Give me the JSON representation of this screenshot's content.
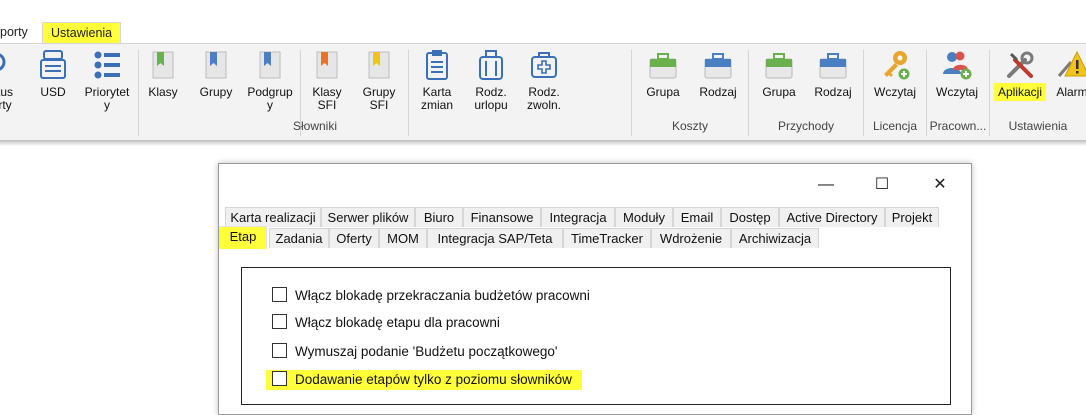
{
  "menu": {
    "tab_partial": "porty",
    "tab_active": "Ustawienia"
  },
  "ribbon": {
    "buttons": [
      {
        "id": "status",
        "label": "tus\nrty"
      },
      {
        "id": "usd",
        "label": "USD"
      },
      {
        "id": "priorytety",
        "label": "Priorytet\ny"
      },
      {
        "id": "klasy",
        "label": "Klasy"
      },
      {
        "id": "grupy",
        "label": "Grupy"
      },
      {
        "id": "podgrupy",
        "label": "Podgrup\ny"
      },
      {
        "id": "klasy_sfi",
        "label": "Klasy\nSFI"
      },
      {
        "id": "grupy_sfi",
        "label": "Grupy\nSFI"
      },
      {
        "id": "karta_zmian",
        "label": "Karta\nzmian"
      },
      {
        "id": "rodz_urlopu",
        "label": "Rodz.\nurlopu"
      },
      {
        "id": "rodz_zwoln",
        "label": "Rodz.\nzwoln."
      },
      {
        "id": "koszty_grupa",
        "label": "Grupa"
      },
      {
        "id": "koszty_rodzaj",
        "label": "Rodzaj"
      },
      {
        "id": "przychody_grupa",
        "label": "Grupa"
      },
      {
        "id": "przychody_rodzaj",
        "label": "Rodzaj"
      },
      {
        "id": "licencja_wczytaj",
        "label": "Wczytaj"
      },
      {
        "id": "pracown_wczytaj",
        "label": "Wczytaj"
      },
      {
        "id": "aplikacji",
        "label": "Aplikacji"
      },
      {
        "id": "alarm",
        "label": "Alarm"
      }
    ],
    "groups": {
      "slowniki": "Słowniki",
      "koszty": "Koszty",
      "przychody": "Przychody",
      "licencja": "Licencja",
      "pracown": "Pracown...",
      "ustawienia": "Ustawienia"
    }
  },
  "dialog": {
    "window_controls": {
      "minimize": "—",
      "maximize": "☐",
      "close": "✕"
    },
    "tabs_row1": [
      "Karta realizacji",
      "Serwer plików",
      "Biuro",
      "Finansowe",
      "Integracja",
      "Moduły",
      "Email",
      "Dostęp",
      "Active Directory",
      "Projekt"
    ],
    "tabs_row2": [
      "Etap",
      "Zadania",
      "Oferty",
      "MOM",
      "Integracja SAP/Teta",
      "TimeTracker",
      "Wdrożenie",
      "Archiwizacja"
    ],
    "active_tab": "Etap",
    "options": [
      {
        "label": "Włącz blokadę przekraczania budżetów pracowni",
        "checked": false
      },
      {
        "label": "Włącz blokadę etapu dla pracowni",
        "checked": false
      },
      {
        "label": "Wymuszaj podanie 'Budżetu początkowego'",
        "checked": false
      },
      {
        "label": "Dodawanie etapów tylko z poziomu słowników",
        "checked": false
      }
    ]
  },
  "colors": {
    "highlight": "#ffff3a",
    "ribbon_bg": "#f3f3f3",
    "icon_blue": "#4a7fc1",
    "icon_green": "#6ab04c",
    "icon_orange": "#e8742c"
  }
}
